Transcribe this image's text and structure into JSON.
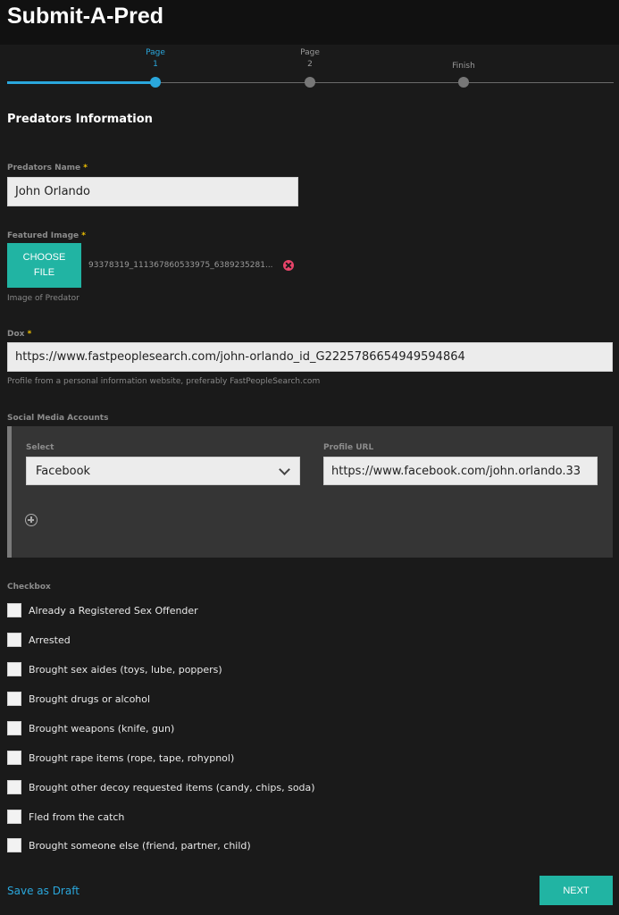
{
  "app": {
    "title": "Submit-A-Pred"
  },
  "progress": {
    "steps": [
      {
        "line1": "Page",
        "line2": "1"
      },
      {
        "line1": "Page",
        "line2": "2"
      },
      {
        "line1": "Finish",
        "line2": ""
      }
    ],
    "active_step": 1
  },
  "section": {
    "heading": "Predators Information"
  },
  "predator_name": {
    "label": "Predators Name",
    "required_mark": "*",
    "value": "John Orlando"
  },
  "featured_image": {
    "label": "Featured Image",
    "required_mark": "*",
    "button_line1": "CHOOSE",
    "button_line2": "FILE",
    "file_name": "93378319_111367860533975_6389235281...",
    "help": "Image of Predator",
    "remove_icon": "close-circle-icon"
  },
  "dox": {
    "label": "Dox",
    "required_mark": "*",
    "value": "https://www.fastpeoplesearch.com/john-orlando_id_G2225786654949594864",
    "help": "Profile from a personal information website, preferably FastPeopleSearch.com"
  },
  "social": {
    "label": "Social Media Accounts",
    "select_label": "Select",
    "select_value": "Facebook",
    "url_label": "Profile URL",
    "url_value": "https://www.facebook.com/john.orlando.33",
    "add_icon": "plus-circle-icon"
  },
  "checkbox_section": {
    "label": "Checkbox",
    "items": [
      "Already a Registered Sex Offender",
      "Arrested",
      "Brought sex aides (toys, lube, poppers)",
      "Brought drugs or alcohol",
      "Brought weapons (knife, gun)",
      "Brought rape items (rope, tape, rohypnol)",
      "Brought other decoy requested items (candy, chips, soda)",
      "Fled from the catch",
      "Brought someone else (friend, partner, child)"
    ]
  },
  "footer": {
    "draft_label": "Save as Draft",
    "next_label": "NEXT"
  },
  "colors": {
    "accent": "#21b4a3",
    "link": "#2aa7dc",
    "required": "#f0c000",
    "danger": "#e8446a"
  }
}
